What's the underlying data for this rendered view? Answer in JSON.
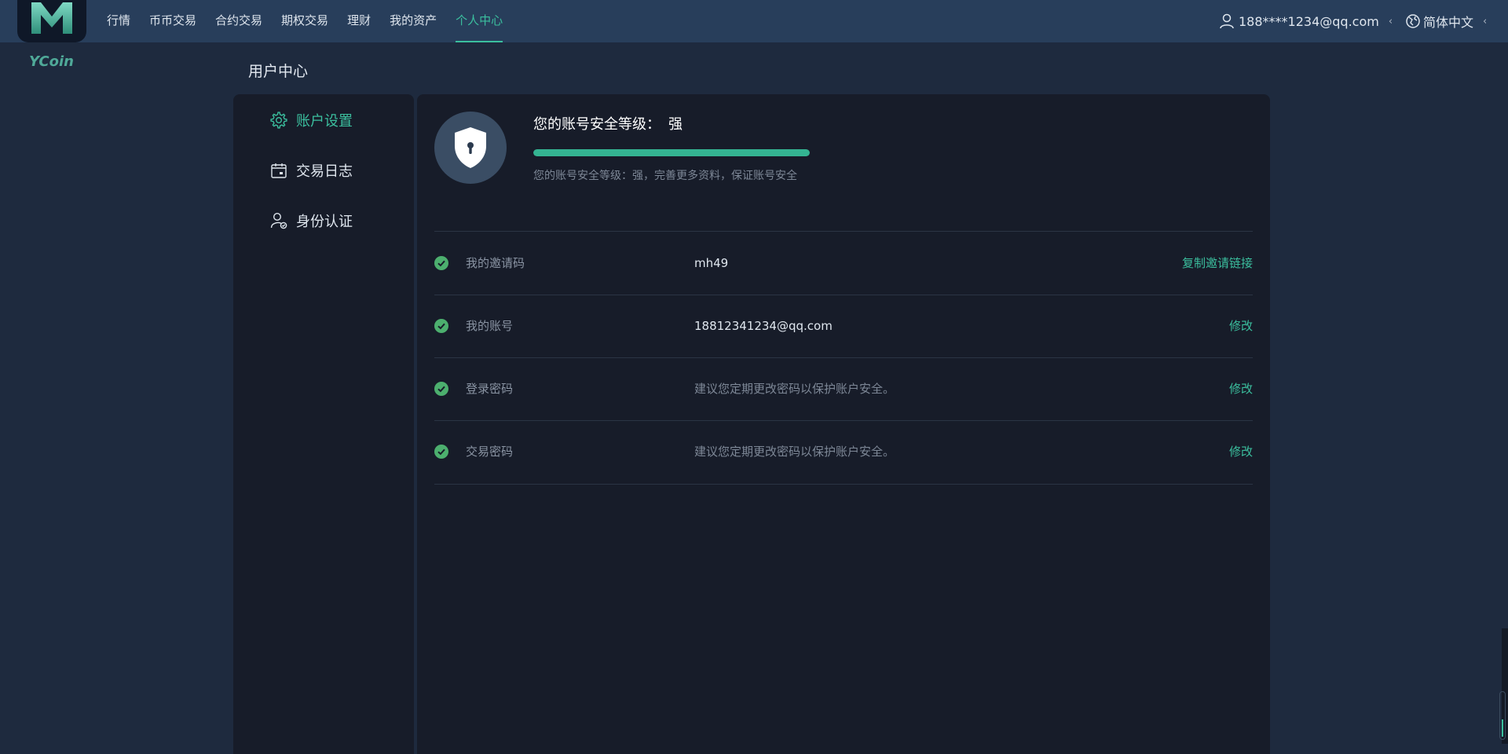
{
  "brand": {
    "name": "YCoin"
  },
  "nav": {
    "items": [
      {
        "label": "行情",
        "active": false
      },
      {
        "label": "币币交易",
        "active": false
      },
      {
        "label": "合约交易",
        "active": false
      },
      {
        "label": "期权交易",
        "active": false
      },
      {
        "label": "理财",
        "active": false
      },
      {
        "label": "我的资产",
        "active": false
      },
      {
        "label": "个人中心",
        "active": true
      }
    ]
  },
  "header": {
    "user": {
      "icon": "user-icon",
      "label": "188****1234@qq.com",
      "chevron": "‹"
    },
    "language": {
      "icon": "globe-icon",
      "label": "简体中文",
      "chevron": "‹"
    }
  },
  "page": {
    "title": "用户中心"
  },
  "sidebar": {
    "items": [
      {
        "label": "账户设置",
        "icon": "gear-icon",
        "active": true
      },
      {
        "label": "交易日志",
        "icon": "calendar-icon",
        "active": false
      },
      {
        "label": "身份认证",
        "icon": "user-verify-icon",
        "active": false
      }
    ]
  },
  "security": {
    "title": "您的账号安全等级：",
    "level": "强",
    "progress": 1.0,
    "description": "您的账号安全等级：强，完善更多资料，保证账号安全"
  },
  "rows": [
    {
      "label": "我的邀请码",
      "value": "mh49",
      "action": "复制邀请链接"
    },
    {
      "label": "我的账号",
      "value": "18812341234@qq.com",
      "action": "修改"
    },
    {
      "label": "登录密码",
      "value": "建议您定期更改密码以保护账户安全。",
      "action": "修改"
    },
    {
      "label": "交易密码",
      "value": "建议您定期更改密码以保护账户安全。",
      "action": "修改"
    }
  ],
  "colors": {
    "accent": "#3bbf9e",
    "topbar": "#283e5b",
    "background": "#1e2a3e",
    "panel": "#171c29",
    "progress": "#34b492",
    "check": "#4caf6e"
  }
}
